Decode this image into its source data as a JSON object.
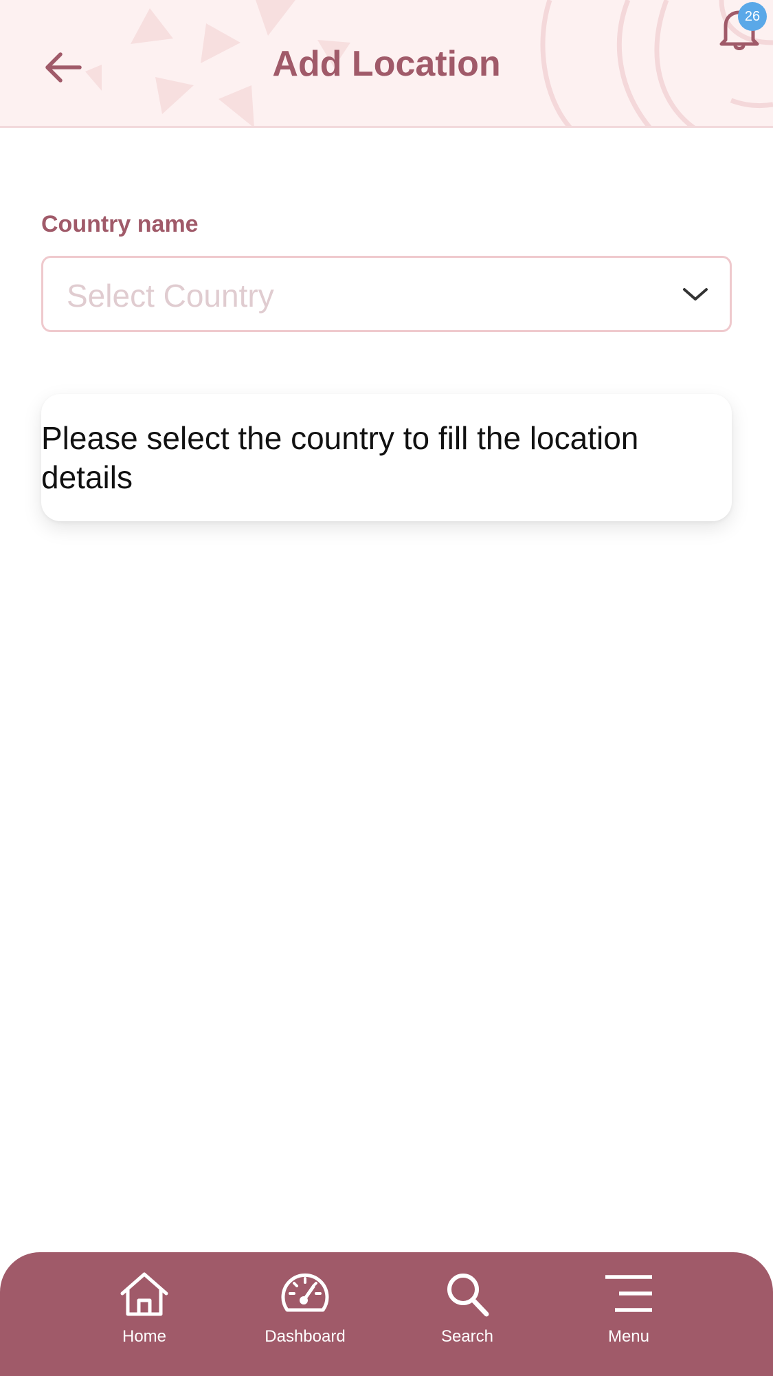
{
  "header": {
    "title": "Add Location",
    "notification_count": "26",
    "accent_color": "#a05a69",
    "background_color": "#fdf1f1"
  },
  "form": {
    "country_label": "Country name",
    "country_placeholder": "Select Country"
  },
  "info": {
    "message": "Please select the country to fill the location details"
  },
  "bottom_nav": {
    "items": [
      {
        "label": "Home",
        "icon": "home-icon"
      },
      {
        "label": "Dashboard",
        "icon": "speedometer-icon"
      },
      {
        "label": "Search",
        "icon": "search-icon"
      },
      {
        "label": "Menu",
        "icon": "menu-icon"
      }
    ],
    "background_color": "#a05a69"
  }
}
